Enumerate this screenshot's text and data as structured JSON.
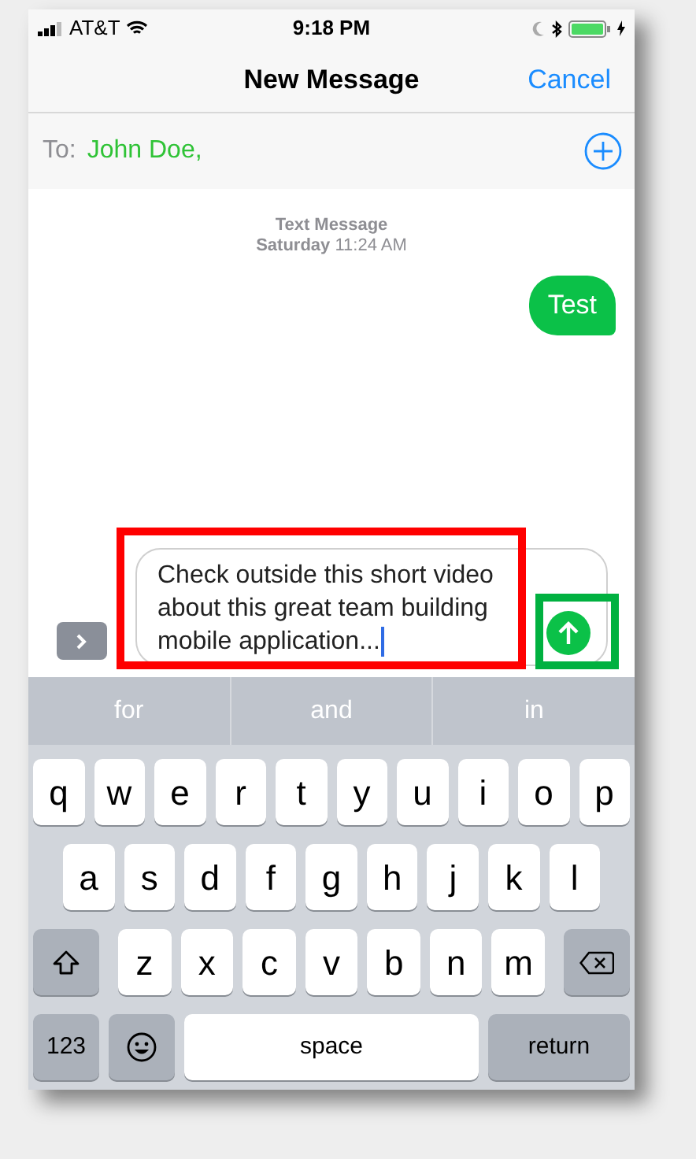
{
  "status_bar": {
    "carrier": "AT&T",
    "time": "9:18 PM"
  },
  "nav": {
    "title": "New Message",
    "cancel": "Cancel"
  },
  "to": {
    "label": "To:",
    "recipient": "John Doe,"
  },
  "thread": {
    "header": "Text Message",
    "timestamp": "**Saturday** 11:24 AM",
    "messages": [
      {
        "text": "Test",
        "outgoing": true
      }
    ]
  },
  "compose": {
    "value": "Check outside this short video about this great team building mobile application..."
  },
  "suggestions": [
    "for",
    "and",
    "in"
  ],
  "keyboard": {
    "row_1": [
      {
        "kind": "letter",
        "label": "q"
      },
      {
        "kind": "letter",
        "label": "w"
      },
      {
        "kind": "letter",
        "label": "e"
      },
      {
        "kind": "letter",
        "label": "r"
      },
      {
        "kind": "letter",
        "label": "t"
      },
      {
        "kind": "letter",
        "label": "y"
      },
      {
        "kind": "letter",
        "label": "u"
      },
      {
        "kind": "letter",
        "label": "i"
      },
      {
        "kind": "letter",
        "label": "o"
      },
      {
        "kind": "letter",
        "label": "p"
      }
    ],
    "row_2": [
      {
        "kind": "letter",
        "label": "a"
      },
      {
        "kind": "letter",
        "label": "s"
      },
      {
        "kind": "letter",
        "label": "d"
      },
      {
        "kind": "letter",
        "label": "f"
      },
      {
        "kind": "letter",
        "label": "g"
      },
      {
        "kind": "letter",
        "label": "h"
      },
      {
        "kind": "letter",
        "label": "j"
      },
      {
        "kind": "letter",
        "label": "k"
      },
      {
        "kind": "letter",
        "label": "l"
      }
    ],
    "row_3": [
      {
        "kind": "shift"
      },
      {
        "kind": "letter",
        "label": "z"
      },
      {
        "kind": "letter",
        "label": "x"
      },
      {
        "kind": "letter",
        "label": "c"
      },
      {
        "kind": "letter",
        "label": "v"
      },
      {
        "kind": "letter",
        "label": "b"
      },
      {
        "kind": "letter",
        "label": "n"
      },
      {
        "kind": "letter",
        "label": "m"
      },
      {
        "kind": "delete"
      }
    ],
    "row_4": [
      {
        "kind": "mode",
        "label": "123"
      },
      {
        "kind": "emoji"
      },
      {
        "kind": "space",
        "label": "space"
      },
      {
        "kind": "return",
        "label": "return"
      }
    ]
  },
  "annotations": [
    {
      "color": "#ff0000"
    },
    {
      "color": "#00b140"
    }
  ]
}
